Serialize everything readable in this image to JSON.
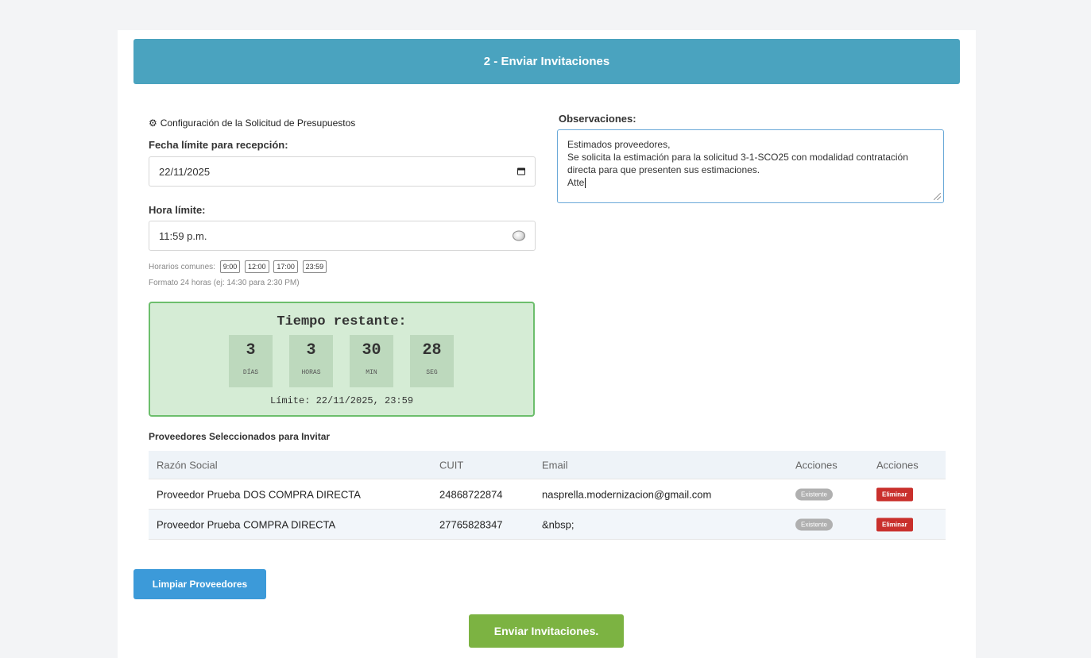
{
  "header": {
    "title": "2 - Enviar Invitaciones"
  },
  "config": {
    "section_title": "Configuración de la Solicitud de Presupuestos",
    "deadline_label": "Fecha límite para recepción:",
    "deadline_value": "22/11/2025",
    "time_label": "Hora límite:",
    "time_value": "11:59 p.m.",
    "common_times_label": "Horarios comunes:",
    "common_times": [
      "9:00",
      "12:00",
      "17:00",
      "23:59"
    ],
    "format_hint": "Formato 24 horas (ej: 14:30 para 2:30 PM)"
  },
  "countdown": {
    "title": "Tiempo restante:",
    "days": "3",
    "days_label": "DÍAS",
    "hours": "3",
    "hours_label": "HORAS",
    "minutes": "30",
    "minutes_label": "MIN",
    "seconds": "28",
    "seconds_label": "SEG",
    "limit": "Límite: 22/11/2025, 23:59"
  },
  "observations": {
    "label": "Observaciones:",
    "value": "Estimados proveedores,\nSe solicita la estimación para la solicitud 3-1-SCO25 con modalidad contratación directa para que presenten sus estimaciones.\nAtte"
  },
  "suppliers": {
    "title": "Proveedores Seleccionados para Invitar",
    "columns": [
      "Razón Social",
      "CUIT",
      "Email",
      "Acciones",
      "Acciones"
    ],
    "rows": [
      {
        "name": "Proveedor Prueba DOS COMPRA DIRECTA",
        "cuit": "24868722874",
        "email": "nasprella.modernizacion@gmail.com",
        "status": "Existente",
        "action": "Eliminar"
      },
      {
        "name": "Proveedor Prueba COMPRA DIRECTA",
        "cuit": "27765828347",
        "email": "&nbsp;",
        "status": "Existente",
        "action": "Eliminar"
      }
    ]
  },
  "buttons": {
    "clear_suppliers": "Limpiar Proveedores",
    "send_invitations": "Enviar Invitaciones."
  },
  "colors": {
    "header": "#4aa3bf",
    "countdown_bg": "#d5ecd5",
    "countdown_border": "#6cbe6c",
    "danger": "#c9302c",
    "primary": "#3c9ad9",
    "success": "#7cb342"
  }
}
